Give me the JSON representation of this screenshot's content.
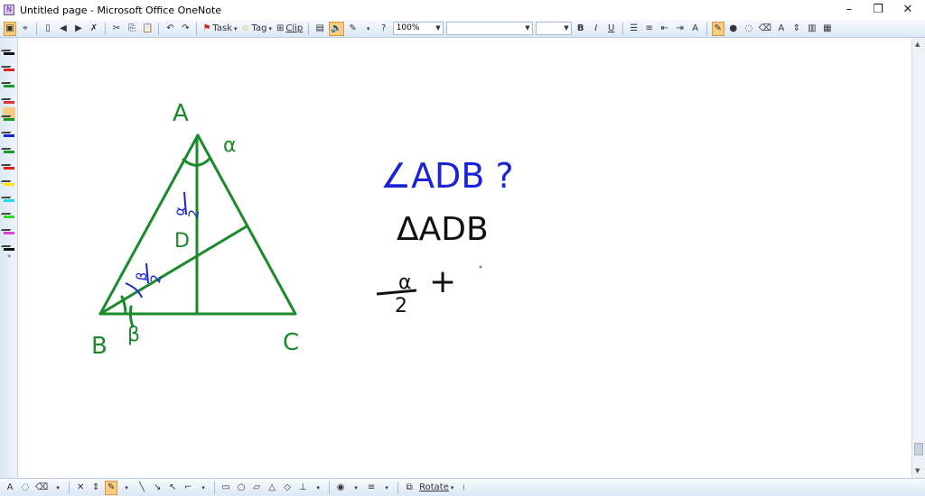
{
  "window": {
    "title": "Untitled page - Microsoft Office OneNote"
  },
  "toolbar": {
    "task_label": "Task",
    "tag_label": "Tag",
    "clip_label": "Clip",
    "zoom_value": "100%",
    "font_name": "",
    "font_size": ""
  },
  "bottom_toolbar": {
    "rotate_label": "Rotate"
  },
  "canvas": {
    "labels": {
      "A": "A",
      "B": "B",
      "C": "C",
      "D": "D",
      "alpha": "α",
      "beta": "β",
      "beta_half_num": "β",
      "beta_half_den": "2",
      "alpha_half_num": "α",
      "alpha_half_den": "2"
    },
    "notes": {
      "angle_question": "∠ADB ?",
      "triangle": "ΔADB",
      "alpha_frac_num": "α",
      "alpha_frac_den": "2",
      "plus": "+"
    }
  },
  "colors": {
    "triangle_ink": "#1b8a2a",
    "blue_ink": "#1a24d6",
    "black_ink": "#111111",
    "accent": "#f8cc82"
  }
}
